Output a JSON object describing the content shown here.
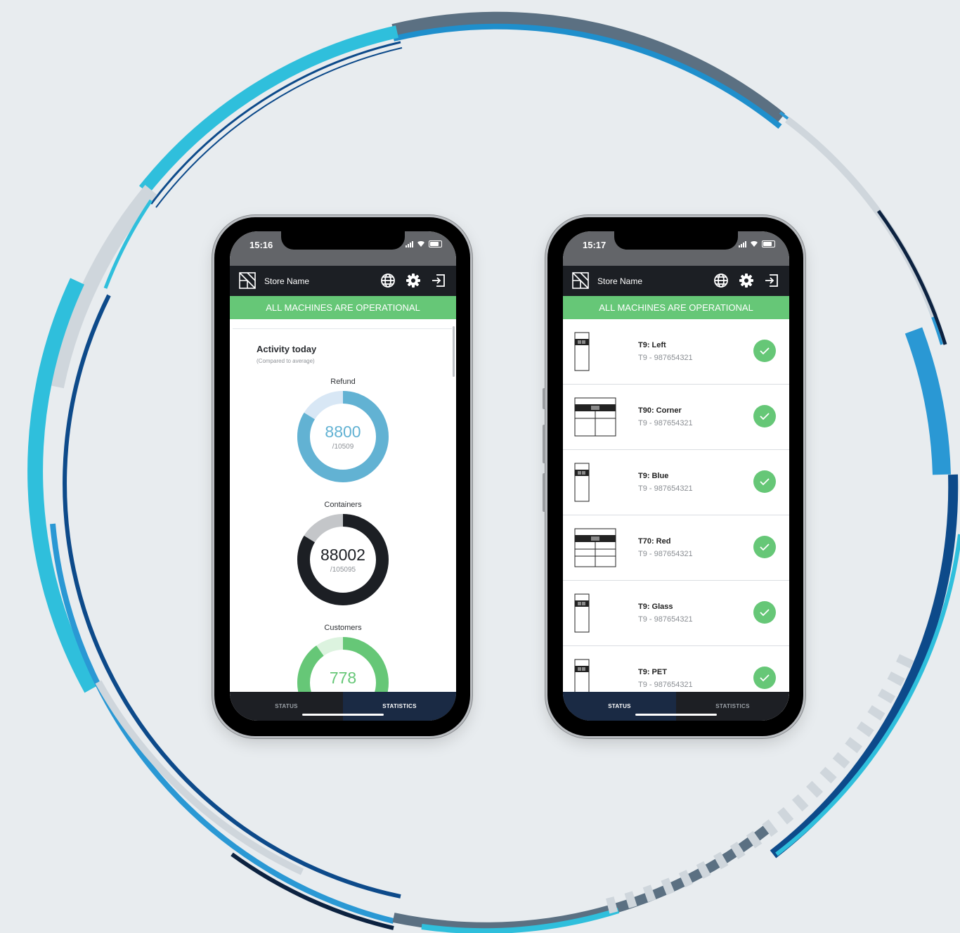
{
  "left_phone": {
    "status_bar": {
      "time": "15:16"
    },
    "header": {
      "store_name": "Store Name",
      "icons": [
        "logo-icon",
        "globe-icon",
        "gear-icon",
        "logout-icon"
      ]
    },
    "banner": "ALL MACHINES ARE OPERATIONAL",
    "activity": {
      "title": "Activity today",
      "subtitle": "(Compared to average)",
      "gauges": [
        {
          "label": "Refund",
          "value": "8800",
          "total": "/10509",
          "fraction": 0.837,
          "color": "#62b2d3",
          "track": "#d8e7f5",
          "value_color": "#62b2d3"
        },
        {
          "label": "Containers",
          "value": "88002",
          "total": "/105095",
          "fraction": 0.837,
          "color": "#1c1f24",
          "track": "#c4c6c9",
          "value_color": "#1c1f24"
        },
        {
          "label": "Customers",
          "value": "778",
          "total": "",
          "fraction": 0.9,
          "color": "#66c777",
          "track": "#dcf3df",
          "value_color": "#66c777"
        }
      ]
    },
    "tabs": {
      "status": "STATUS",
      "statistics": "STATISTICS",
      "active": "statistics"
    }
  },
  "right_phone": {
    "status_bar": {
      "time": "15:17"
    },
    "header": {
      "store_name": "Store Name",
      "icons": [
        "logo-icon",
        "globe-icon",
        "gear-icon",
        "logout-icon"
      ]
    },
    "banner": "ALL MACHINES ARE OPERATIONAL",
    "machines": [
      {
        "name": "T9: Left",
        "serial": "T9 - 987654321",
        "type": "single",
        "status_icon": "check-icon"
      },
      {
        "name": "T90: Corner",
        "serial": "T9 - 987654321",
        "type": "wide",
        "status_icon": "check-icon"
      },
      {
        "name": "T9: Blue",
        "serial": "T9 - 987654321",
        "type": "single",
        "status_icon": "check-icon"
      },
      {
        "name": "T70: Red",
        "serial": "T9 - 987654321",
        "type": "wide",
        "status_icon": "check-icon"
      },
      {
        "name": "T9: Glass",
        "serial": "T9 - 987654321",
        "type": "single",
        "status_icon": "check-icon"
      },
      {
        "name": "T9: PET",
        "serial": "T9 - 987654321",
        "type": "single",
        "status_icon": "check-icon"
      }
    ],
    "tabs": {
      "status": "STATUS",
      "statistics": "STATISTICS",
      "active": "status"
    }
  },
  "colors": {
    "background": "#e8ecef",
    "banner_green": "#66c777",
    "appbar": "#1c1f24",
    "ok_green": "#66c777"
  }
}
